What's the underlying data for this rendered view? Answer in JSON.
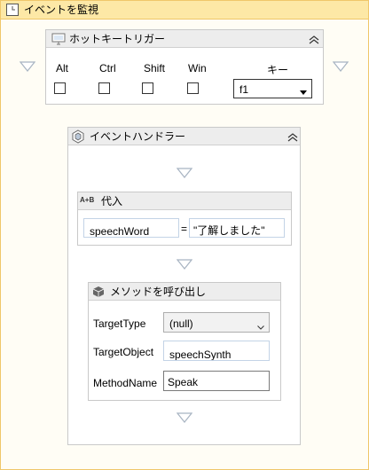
{
  "outer": {
    "title": "イベントを監視"
  },
  "hotkey": {
    "title": "ホットキートリガー",
    "col_alt": "Alt",
    "col_ctrl": "Ctrl",
    "col_shift": "Shift",
    "col_win": "Win",
    "col_key": "キー",
    "key_value": "f1",
    "alt_checked": false,
    "ctrl_checked": false,
    "shift_checked": false,
    "win_checked": false
  },
  "handler": {
    "title": "イベントハンドラー"
  },
  "assign": {
    "title": "代入",
    "badge": "A+B",
    "left_value": "speechWord",
    "equals": "=",
    "right_value": "\"了解しました\""
  },
  "invoke": {
    "title": "メソッドを呼び出し",
    "target_type_label": "TargetType",
    "target_type_value": "(null)",
    "target_object_label": "TargetObject",
    "target_object_value": "speechSynth",
    "method_name_label": "MethodName",
    "method_name_value": "Speak"
  },
  "colors": {
    "outer_border": "#f0c76a",
    "outer_header": "#fde8a6",
    "drop_arrow": "#a8b4c2"
  }
}
